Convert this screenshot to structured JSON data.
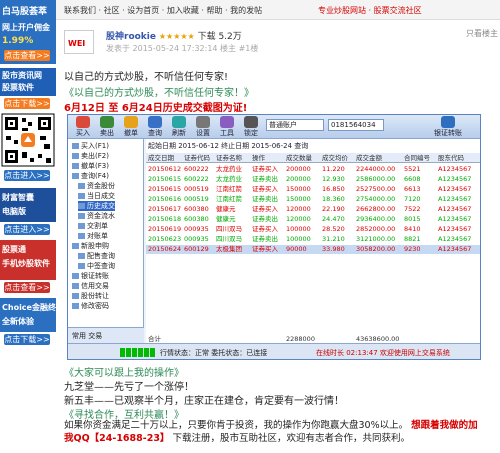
{
  "topbar": {
    "left_text": "联系我们 · 社区 · 设为首页 · 加入收藏 · 帮助 · 我的发帖",
    "right_text": "专业炒股网站 · 股票交流社区"
  },
  "ads": {
    "ad1_title": "白马股荟萃",
    "ad1_sub": "网上开户佣金",
    "ad1_rate": "1.99%",
    "ad1_btn": "点击查看>>",
    "ad2_title": "股市资讯网",
    "ad2_sub": "股票软件",
    "ad2_btn": "点击下载>>",
    "ad3_btn": "点击进入>>",
    "ad4_title": "财富智囊",
    "ad4_sub": "电脑版",
    "ad4_btn": "点击进入>>",
    "ad5_title": "股票通",
    "ad5_sub": "手机炒股软件",
    "ad5_btn": "点击查看>>",
    "ad6_title": "Choice金融终端",
    "ad6_sub": "全新体验",
    "ad6_btn": "点击下载>>"
  },
  "post": {
    "avatar_text": "WEI",
    "author": "股神rookie",
    "rating": "★★★★★",
    "downloads": "下载 5.2万",
    "ontop": "只看楼主",
    "meta": "发表于 2015-05-24 17:32:14  楼主  #1楼",
    "line1": "以自己的方式炒股，不听信任何专家!",
    "line2": "《以自己的方式炒股，不听信任何专家！》",
    "line3": "6月12日 至 6月24日历史成交截图为证!",
    "section2_title": "《大家可以跟上我的操作》",
    "section2_line1": "九芝堂——先亏了一个涨停！",
    "section2_line2": "新五丰——已观察半个月，庄家正在建仓，肯定要有一波行情！",
    "section3_title": "《寻找合作，互利共赢！》",
    "section3_text1": "如果你资金满足二十万以上，只要你肯于投资，我的操作为你跑赢大盘30%以上。",
    "section3_text2": "想跟着我做的加我QQ",
    "qq": "【24-1688-23】",
    "section3_text3": "下载注册，股市互助社区，欢迎有志者合作，共同获利。"
  },
  "software": {
    "toolbar": [
      "买入",
      "卖出",
      "撤单",
      "查询",
      "刷新",
      "设置",
      "工具",
      "锁定"
    ],
    "account_select": "普通账户",
    "account_no": "0181564034",
    "transfer_label": "银证转账",
    "tree": [
      "买入(F1)",
      "卖出(F2)",
      "撤单(F3)",
      "查询(F4)",
      "资金股份",
      "当日成交",
      "历史成交",
      "资金流水",
      "交割单",
      "对账单",
      "新股申购",
      "配售查询",
      "中签查询",
      "银证转账",
      "信用交易",
      "股份转让",
      "修改密码"
    ],
    "tree_selected": "历史成交",
    "tabs": "常用  交易  ",
    "query_label": "起始日期 2015-06-12   终止日期 2015-06-24   查询",
    "columns": [
      "成交日期",
      "证券代码",
      "证券名称",
      "操作",
      "成交数量",
      "成交均价",
      "成交金额",
      "合同编号",
      "股东代码"
    ],
    "rows": [
      [
        "20150612",
        "600222",
        "太龙药业",
        "证券买入",
        "200000",
        "11.220",
        "2244000.00",
        "5521",
        "A1234567"
      ],
      [
        "20150615",
        "600222",
        "太龙药业",
        "证券卖出",
        "200000",
        "12.930",
        "2586000.00",
        "6608",
        "A1234567"
      ],
      [
        "20150615",
        "000519",
        "江南红箭",
        "证券买入",
        "150000",
        "16.850",
        "2527500.00",
        "6613",
        "A1234567"
      ],
      [
        "20150616",
        "000519",
        "江南红箭",
        "证券卖出",
        "150000",
        "18.360",
        "2754000.00",
        "7120",
        "A1234567"
      ],
      [
        "20150617",
        "600380",
        "健康元",
        "证券买入",
        "120000",
        "22.190",
        "2662800.00",
        "7522",
        "A1234567"
      ],
      [
        "20150618",
        "600380",
        "健康元",
        "证券卖出",
        "120000",
        "24.470",
        "2936400.00",
        "8015",
        "A1234567"
      ],
      [
        "20150619",
        "000935",
        "四川双马",
        "证券买入",
        "100000",
        "28.520",
        "2852000.00",
        "8410",
        "A1234567"
      ],
      [
        "20150623",
        "000935",
        "四川双马",
        "证券卖出",
        "100000",
        "31.210",
        "3121000.00",
        "8821",
        "A1234567"
      ],
      [
        "20150624",
        "600129",
        "太极集团",
        "证券买入",
        "90000",
        "33.980",
        "3058200.00",
        "9230",
        "A1234567"
      ]
    ],
    "footer_left": "合计",
    "footer_mid": "2288000",
    "footer_right": "43638600.00",
    "status_text": "行情状态：正常   委托状态：已连接",
    "status_right": "在线时长 02:13:47   欢迎使用网上交易系统"
  },
  "colors": {
    "accent_red": "#d60000",
    "accent_green": "#2e8b57",
    "ad_blue": "#2b6fc1",
    "ad_orange": "#f47b20"
  }
}
